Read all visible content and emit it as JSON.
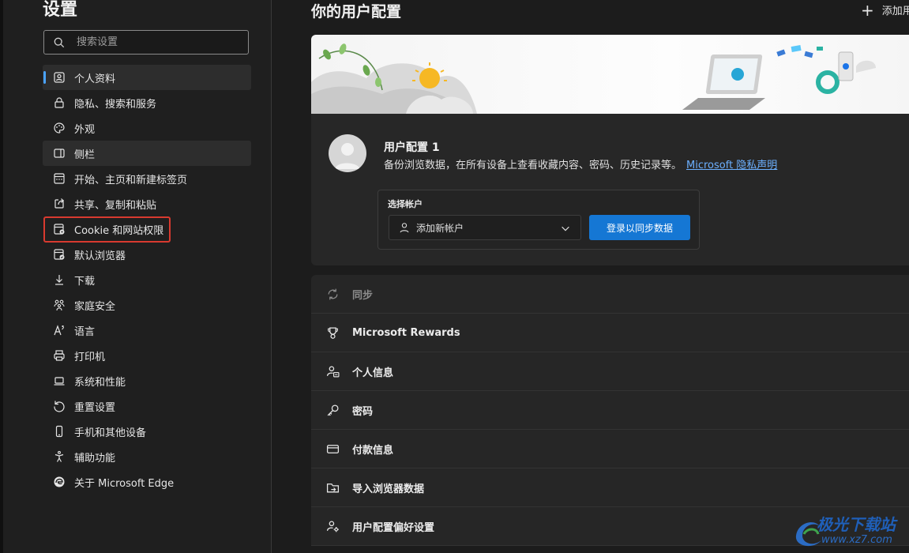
{
  "sidebar": {
    "title": "设置",
    "search_placeholder": "搜索设置",
    "items": [
      {
        "label": "个人资料",
        "icon": "profile-icon"
      },
      {
        "label": "隐私、搜索和服务",
        "icon": "lock-icon"
      },
      {
        "label": "外观",
        "icon": "palette-icon"
      },
      {
        "label": "侧栏",
        "icon": "sidebar-icon"
      },
      {
        "label": "开始、主页和新建标签页",
        "icon": "home-tab-icon"
      },
      {
        "label": "共享、复制和粘贴",
        "icon": "share-icon"
      },
      {
        "label": "Cookie 和网站权限",
        "icon": "cookie-site-icon"
      },
      {
        "label": "默认浏览器",
        "icon": "default-browser-icon"
      },
      {
        "label": "下载",
        "icon": "download-icon"
      },
      {
        "label": "家庭安全",
        "icon": "family-icon"
      },
      {
        "label": "语言",
        "icon": "language-icon"
      },
      {
        "label": "打印机",
        "icon": "printer-icon"
      },
      {
        "label": "系统和性能",
        "icon": "laptop-icon"
      },
      {
        "label": "重置设置",
        "icon": "reset-icon"
      },
      {
        "label": "手机和其他设备",
        "icon": "phone-icon"
      },
      {
        "label": "辅助功能",
        "icon": "accessibility-icon"
      },
      {
        "label": "关于 Microsoft Edge",
        "icon": "edge-logo-icon"
      }
    ]
  },
  "main": {
    "title": "你的用户配置",
    "add_profile_label": "添加用",
    "profile": {
      "name": "用户配置 1",
      "description": "备份浏览数据，在所有设备上查看收藏内容、密码、历史记录等。",
      "privacy_link": "Microsoft 隐私声明",
      "account_label": "选择帐户",
      "account_select_value": "添加新帐户",
      "sync_button": "登录以同步数据"
    },
    "rows": [
      {
        "label": "同步",
        "icon": "sync-icon",
        "disabled": true
      },
      {
        "label": "Microsoft Rewards",
        "icon": "trophy-icon"
      },
      {
        "label": "个人信息",
        "icon": "person-card-icon"
      },
      {
        "label": "密码",
        "icon": "key-icon"
      },
      {
        "label": "付款信息",
        "icon": "credit-card-icon"
      },
      {
        "label": "导入浏览器数据",
        "icon": "import-folder-icon"
      },
      {
        "label": "用户配置偏好设置",
        "icon": "person-gear-icon"
      }
    ]
  },
  "watermark": {
    "name": "极光下载站",
    "url": "www.xz7.com"
  },
  "colors": {
    "accent": "#4aa3ff",
    "sync_button": "#1577d4",
    "highlight_box": "#d83a2f",
    "link": "#6cb0ff"
  }
}
